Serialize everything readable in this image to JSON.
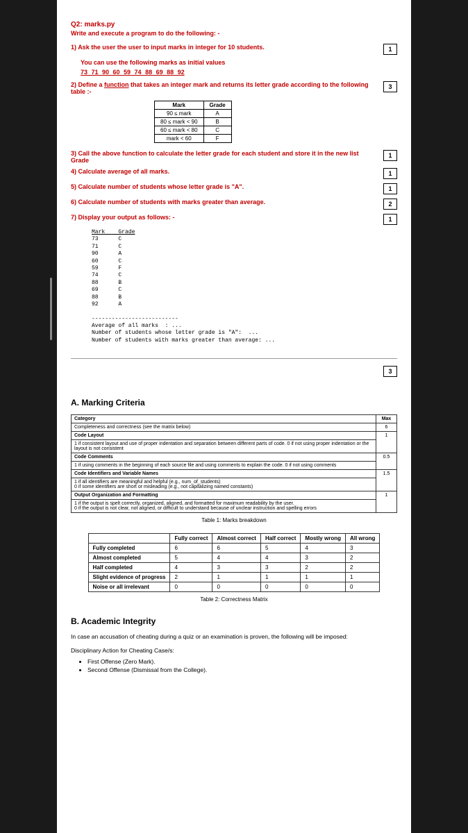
{
  "question": {
    "title": "Q2: marks.py",
    "subtitle": "Write and execute a program to do the following: -",
    "items": [
      {
        "num": "1)",
        "text": "Ask the user the user to input marks in integer for 10 students.",
        "points": "1",
        "sub": "You can use the following marks as initial values",
        "values": "73 71 90 60 59 74 88 69 88 92"
      },
      {
        "num": "2)",
        "text_pre": "Define a ",
        "text_underline": "function",
        "text_post": " that takes an integer mark and returns its letter grade according to the following table :-",
        "points": "3"
      }
    ],
    "grade_table": {
      "headers": [
        "Mark",
        "Grade"
      ],
      "rows": [
        [
          "90 ≤ mark",
          "A"
        ],
        [
          "80 ≤ mark < 90",
          "B"
        ],
        [
          "60 ≤ mark < 80",
          "C"
        ],
        [
          "mark < 60",
          "F"
        ]
      ]
    },
    "items2": [
      {
        "num": "3)",
        "text": "Call the above function to calculate the letter grade for each student and store it in the new list Grade",
        "points": "1"
      },
      {
        "num": "4)",
        "text": "Calculate average of all marks.",
        "points": "1"
      },
      {
        "num": "5)",
        "text": "Calculate number of students whose letter grade is \"A\".",
        "points": "1"
      },
      {
        "num": "6)",
        "text": "Calculate number of students with marks greater than average.",
        "points": "2"
      },
      {
        "num": "7)",
        "text": "Display your output as follows: -",
        "points": "1"
      }
    ],
    "output_sample": {
      "header": "Mark    Grade",
      "rows": [
        "73      C",
        "71      C",
        "90      A",
        "60      C",
        "59      F",
        "74      C",
        "88      B",
        "69      C",
        "88      B",
        "92      A"
      ],
      "sep": "--------------------------",
      "lines": [
        "Average of all marks  : ...",
        "Number of students whose letter grade is \"A\":  ...",
        "Number of students with marks greater than average: ..."
      ]
    },
    "page_total": "3"
  },
  "marking": {
    "heading": "A. Marking Criteria",
    "table1": {
      "headers": [
        "Category",
        "Max"
      ],
      "rows": [
        {
          "cat": "Completeness and correctness (see the matrix below)",
          "max": "6",
          "bold": true
        },
        {
          "cat": "Code Layout",
          "max": "",
          "bold": true
        },
        {
          "cat": "1 if consistent layout and use of proper indentation and separation between different parts of code. 0 if not using proper indentation or the layout is not consistent",
          "max": "1",
          "bold": false
        },
        {
          "cat": "Code Comments",
          "max": "",
          "bold": true
        },
        {
          "cat": "1 if using comments in the beginning of each source file and using comments to explain the code. 0 if not using comments",
          "max": "0.5",
          "bold": false
        },
        {
          "cat": "Code Identifiers and Variable Names",
          "max": "",
          "bold": true
        },
        {
          "cat": "1 if all identifiers are meaningful and helpful (e.g., num_of_students)\n0 if some identifiers are short or misleading (e.g., not capitalizing named constants)",
          "max": "1.5",
          "bold": false
        },
        {
          "cat": "Output Organization and Formatting",
          "max": "",
          "bold": true
        },
        {
          "cat": "1 if the output is spelt correctly, organized, aligned, and formatted for maximum readability by the user.\n0 if the output is not clear, not aligned, or difficult to understand because of unclear instruction and spelling errors",
          "max": "1",
          "bold": false
        }
      ],
      "caption": "Table 1: Marks breakdown"
    },
    "table2": {
      "col_headers": [
        "",
        "Fully correct",
        "Almost correct",
        "Half correct",
        "Mostly wrong",
        "All wrong"
      ],
      "rows": [
        [
          "Fully completed",
          "6",
          "6",
          "5",
          "4",
          "3"
        ],
        [
          "Almost completed",
          "5",
          "4",
          "4",
          "3",
          "2"
        ],
        [
          "Half completed",
          "4",
          "3",
          "3",
          "2",
          "2"
        ],
        [
          "Slight evidence of progress",
          "2",
          "1",
          "1",
          "1",
          "1"
        ],
        [
          "Noise or all irrelevant",
          "0",
          "0",
          "0",
          "0",
          "0"
        ]
      ],
      "caption": "Table 2: Correctness Matrix"
    }
  },
  "integrity": {
    "heading": "B. Academic Integrity",
    "text": "In case an accusation of cheating during a quiz or an examination is proven, the following will be imposed:",
    "sub": "Disciplinary Action for Cheating Case/s:",
    "bullets": [
      "First Offense (Zero Mark).",
      "Second Offense (Dismissal from the College)."
    ]
  }
}
